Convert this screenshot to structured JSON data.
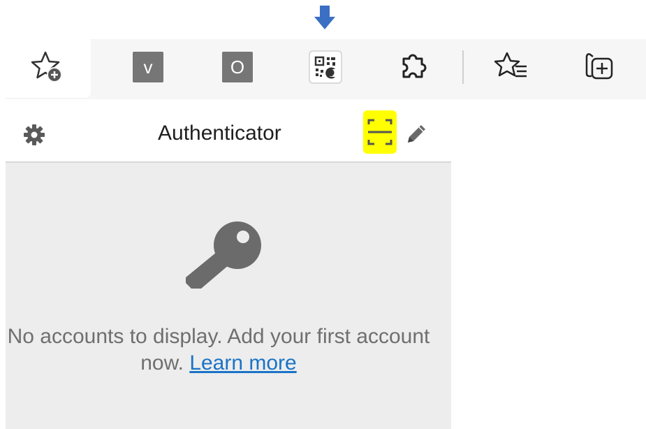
{
  "annotation": {
    "arrow_color": "#3a6fc4",
    "highlight_color": "#ffff00"
  },
  "toolbar": {
    "tabs": [
      {
        "icon": "star-add-icon"
      },
      {
        "icon": "extension-v-icon",
        "label": "v"
      },
      {
        "icon": "extension-o-icon",
        "label": "O"
      },
      {
        "icon": "qr-code-icon"
      },
      {
        "icon": "puzzle-icon"
      },
      {
        "icon": "favorites-list-icon"
      },
      {
        "icon": "collections-add-icon"
      }
    ]
  },
  "popup": {
    "title": "Authenticator",
    "header_icons": [
      "gear-icon",
      "scan-qr-icon",
      "pencil-icon"
    ],
    "empty_state": {
      "icon": "key-icon",
      "message": "No accounts to display. Add your first account now.",
      "link_text": "Learn more"
    },
    "colors": {
      "body_bg": "#ededed",
      "link": "#1a73c7",
      "text": "#6f6f6f"
    }
  }
}
